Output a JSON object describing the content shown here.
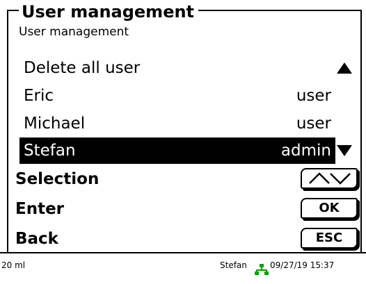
{
  "header": {
    "title": "User management",
    "subtitle": "User management"
  },
  "list": {
    "items": [
      {
        "name": "Delete all user",
        "role": ""
      },
      {
        "name": "Eric",
        "role": "user"
      },
      {
        "name": "Michael",
        "role": "user"
      },
      {
        "name": "Stefan",
        "role": "admin",
        "selected": true
      }
    ]
  },
  "softkeys": {
    "selection_label": "Selection",
    "enter_label": "Enter",
    "enter_key": "OK",
    "back_label": "Back",
    "back_key": "ESC"
  },
  "statusbar": {
    "volume": "20 ml",
    "user": "Stefan",
    "datetime": "09/27/19 15:37",
    "network_icon_color": "#00a000"
  }
}
